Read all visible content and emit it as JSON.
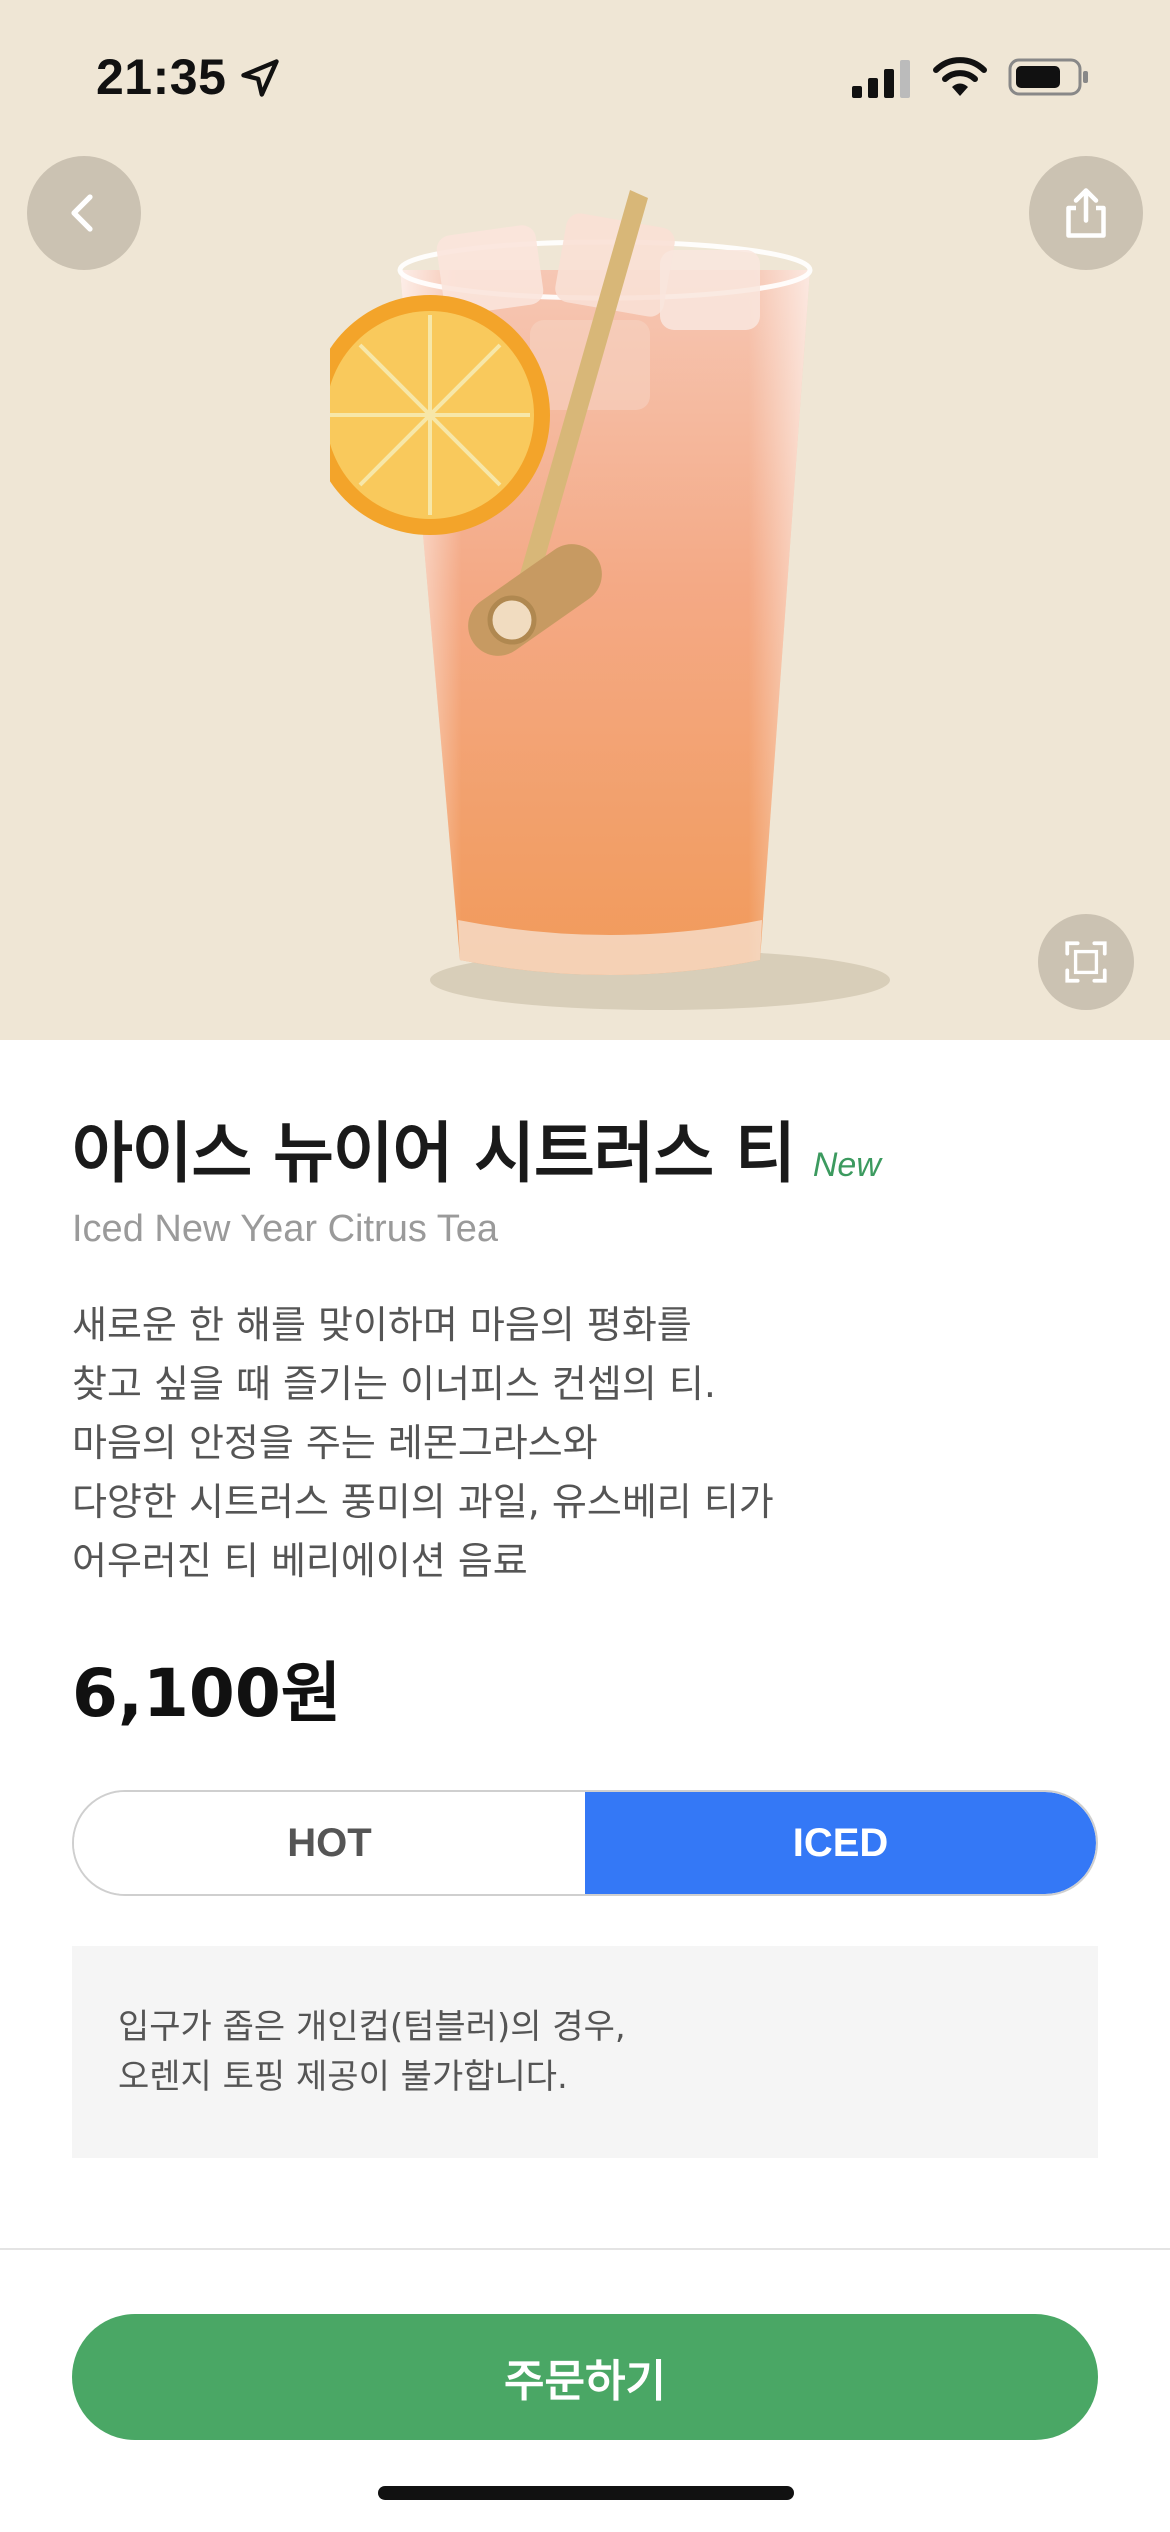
{
  "status_bar": {
    "time": "21:35",
    "icons": [
      "location-arrow-icon",
      "cellular-signal-icon",
      "wifi-icon",
      "battery-icon"
    ]
  },
  "hero": {
    "background_color": "#efe6d5",
    "icons": [
      "back-icon",
      "share-icon",
      "expand-icon"
    ],
    "image": "iced citrus tea glass with orange slice and lemongrass"
  },
  "product": {
    "name_ko": "아이스 뉴이어 시트러스 티",
    "badge": "New",
    "name_en": "Iced New Year Citrus Tea",
    "description_lines": [
      "새로운 한 해를 맞이하며 마음의 평화를",
      "찾고 싶을 때 즐기는 이너피스 컨셉의 티.",
      "마음의 안정을 주는 레몬그라스와",
      "다양한 시트러스 풍미의 과일, 유스베리 티가",
      "어우러진 티 베리에이션 음료"
    ],
    "price": "6,100원"
  },
  "temperature_toggle": {
    "options": [
      "HOT",
      "ICED"
    ],
    "selected": "ICED",
    "accent_color": "#3478f6"
  },
  "notice": {
    "lines": [
      "입구가 좁은 개인컵(텀블러)의 경우,",
      "오렌지 토핑 제공이 불가합니다."
    ]
  },
  "order": {
    "label": "주문하기",
    "color": "#4aa765"
  }
}
